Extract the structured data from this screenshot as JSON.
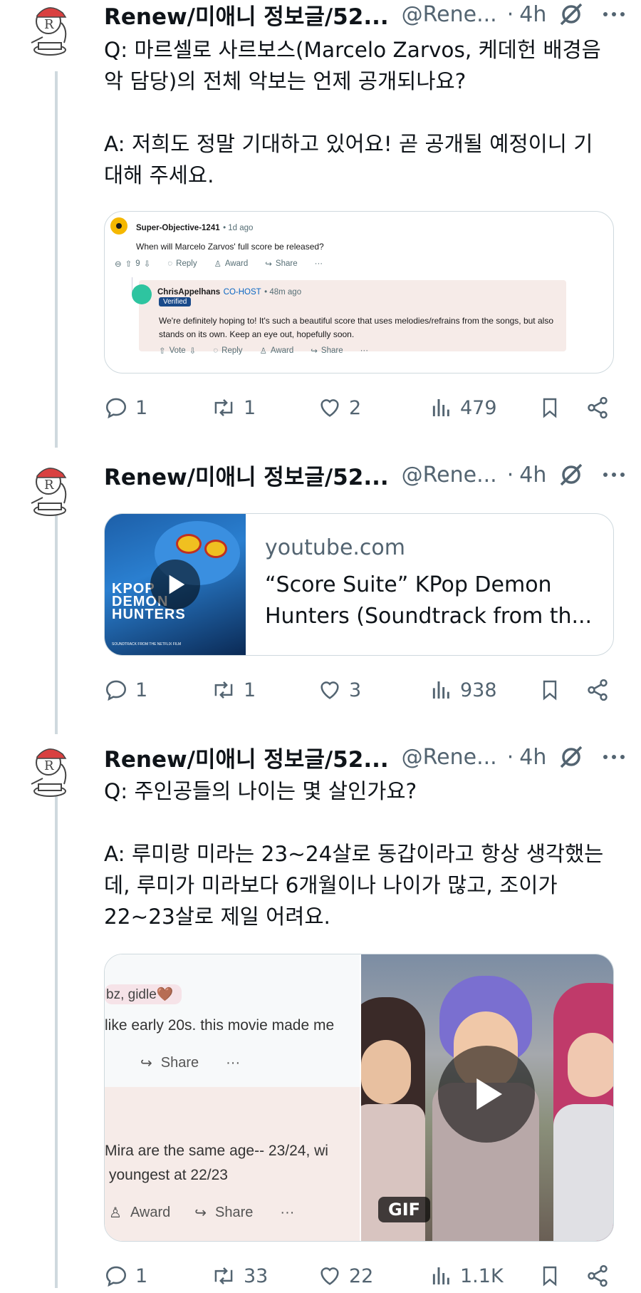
{
  "tweets": [
    {
      "display_name": "Renew/미애니 정보글/52...",
      "handle": "@Rene...",
      "separator": "·",
      "time": "4h",
      "text_lines": [
        "Q: 마르셀로 사르보스(Marcelo Zarvos, 케데헌 배경음",
        "악 담당)의 전체 악보는 언제 공개되나요?",
        "",
        "A: 저희도 정말 기대하고 있어요! 곧 공개될 예정이니 기",
        "대해 주세요."
      ],
      "reddit": {
        "op_user": "Super-Objective-1241",
        "op_time": "• 1d ago",
        "op_text": "When will Marcelo Zarvos' full score be released?",
        "op_votes": "9",
        "reply_label": "Reply",
        "award_label": "Award",
        "share_label": "Share",
        "more_label": "···",
        "reply_user": "ChrisAppelhans",
        "reply_flair": "CO-HOST",
        "reply_time": "• 48m ago",
        "verified_label": "Verified",
        "reply_text_1": "We're definitely hoping to! It's such a beautiful score that uses melodies/refrains from the songs, but also",
        "reply_text_2": "stands on its own. Keep an eye out, hopefully soon.",
        "vote_label": "Vote"
      },
      "stats": {
        "replies": "1",
        "reposts": "1",
        "likes": "2",
        "views": "479"
      }
    },
    {
      "display_name": "Renew/미애니 정보글/52...",
      "handle": "@Rene...",
      "separator": "·",
      "time": "4h",
      "card": {
        "domain": "youtube.com",
        "title": "“Score Suite” KPop Demon Hunters (Soundtrack from th...",
        "thumb_logo_1": "KPOP",
        "thumb_logo_2": "DEMON",
        "thumb_logo_3": "HUNTERS",
        "thumb_caption": "SOUNDTRACK FROM THE NETFLIX FILM"
      },
      "stats": {
        "replies": "1",
        "reposts": "1",
        "likes": "3",
        "views": "938"
      }
    },
    {
      "display_name": "Renew/미애니 정보글/52...",
      "handle": "@Rene...",
      "separator": "·",
      "time": "4h",
      "text_lines": [
        "Q: 주인공들의 나이는 몇 살인가요?",
        "",
        "A: 루미랑 미라는 23~24살로 동갑이라고 항상 생각했는",
        "데, 루미가 미라보다 6개월이나 나이가 많고, 조이가",
        "22~23살로 제일 어려요."
      ],
      "media_left": {
        "tag": "bz, gidle🤎",
        "line1": "like early 20s. this movie made me",
        "share_label": "Share",
        "more_label": "···",
        "line2": "Mira are the same age-- 23/24, wi",
        "line3": "youngest at 22/23",
        "award_label": "Award",
        "share_label_2": "Share",
        "more_label_2": "···"
      },
      "gif_label": "GIF",
      "stats": {
        "replies": "1",
        "reposts": "33",
        "likes": "22",
        "views": "1.1K"
      }
    }
  ]
}
